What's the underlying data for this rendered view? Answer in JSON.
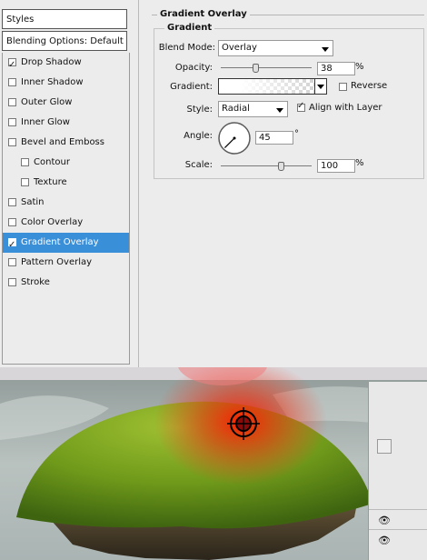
{
  "styles_panel": {
    "title": "Styles",
    "blending_options": "Blending Options: Default",
    "items": [
      {
        "label": "Drop Shadow",
        "checked": true
      },
      {
        "label": "Inner Shadow",
        "checked": false
      },
      {
        "label": "Outer Glow",
        "checked": false
      },
      {
        "label": "Inner Glow",
        "checked": false
      },
      {
        "label": "Bevel and Emboss",
        "checked": false
      },
      {
        "label": "Contour",
        "checked": false
      },
      {
        "label": "Texture",
        "checked": false
      },
      {
        "label": "Satin",
        "checked": false
      },
      {
        "label": "Color Overlay",
        "checked": false
      },
      {
        "label": "Gradient Overlay",
        "checked": true
      },
      {
        "label": "Pattern Overlay",
        "checked": false
      },
      {
        "label": "Stroke",
        "checked": false
      }
    ]
  },
  "gradient_overlay": {
    "section_title": "Gradient Overlay",
    "group_title": "Gradient",
    "blend_mode_label": "Blend Mode:",
    "blend_mode_value": "Overlay",
    "opacity_label": "Opacity:",
    "opacity_value": "38",
    "opacity_unit": "%",
    "gradient_label": "Gradient:",
    "reverse_label": "Reverse",
    "reverse_checked": false,
    "style_label": "Style:",
    "style_value": "Radial",
    "align_label": "Align with Layer",
    "align_checked": true,
    "angle_label": "Angle:",
    "angle_value": "45",
    "angle_unit": "°",
    "scale_label": "Scale:",
    "scale_value": "100",
    "scale_unit": "%"
  },
  "colors": {
    "selection": "#3a8fd9",
    "glow": "#e02010",
    "grass": "#6f9a1a"
  },
  "icons": {
    "visibility": "eye-icon",
    "target": "crosshair-icon"
  }
}
